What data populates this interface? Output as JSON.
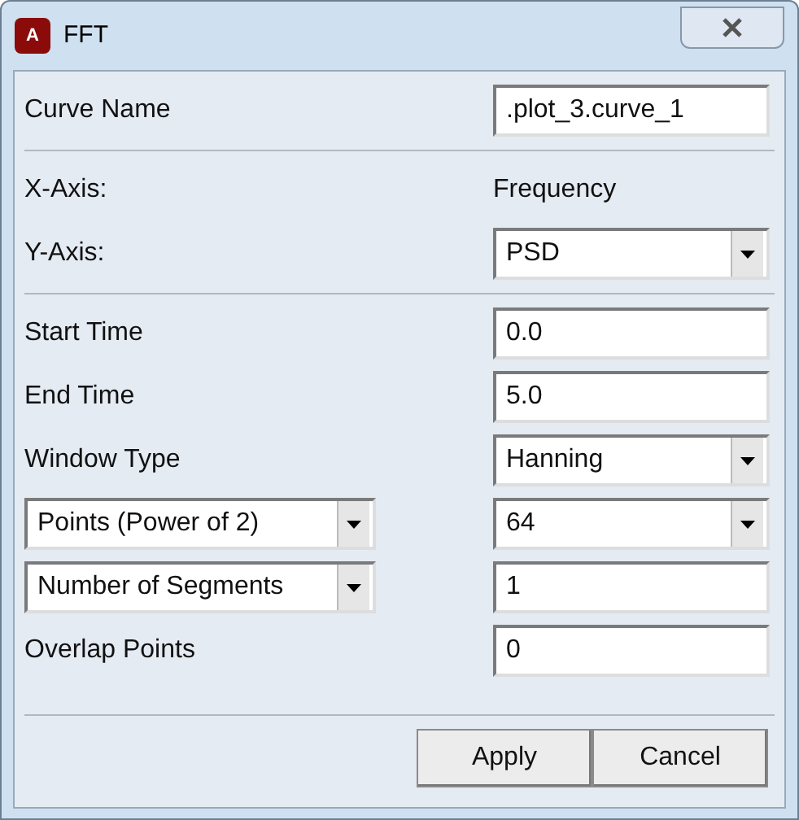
{
  "window": {
    "title": "FFT",
    "icon_letter": "A"
  },
  "sections": [
    [
      {
        "label": {
          "kind": "text",
          "text": "Curve Name"
        },
        "value": {
          "kind": "input",
          "text": ".plot_3.curve_1"
        }
      }
    ],
    [
      {
        "label": {
          "kind": "text",
          "text": "X-Axis:"
        },
        "value": {
          "kind": "text",
          "text": "Frequency"
        }
      },
      {
        "label": {
          "kind": "text",
          "text": "Y-Axis:"
        },
        "value": {
          "kind": "select",
          "text": "PSD"
        }
      }
    ],
    [
      {
        "label": {
          "kind": "text",
          "text": "Start Time"
        },
        "value": {
          "kind": "input",
          "text": "0.0"
        }
      },
      {
        "label": {
          "kind": "text",
          "text": "End Time"
        },
        "value": {
          "kind": "input",
          "text": "5.0"
        }
      },
      {
        "label": {
          "kind": "text",
          "text": "Window Type"
        },
        "value": {
          "kind": "select",
          "text": "Hanning"
        }
      },
      {
        "label": {
          "kind": "select",
          "text": "Points (Power of 2)"
        },
        "value": {
          "kind": "select",
          "text": "64"
        }
      },
      {
        "label": {
          "kind": "select",
          "text": "Number of Segments"
        },
        "value": {
          "kind": "input",
          "text": "1"
        }
      },
      {
        "label": {
          "kind": "text",
          "text": "Overlap Points"
        },
        "value": {
          "kind": "input",
          "text": "0"
        }
      }
    ]
  ],
  "buttons": [
    "Apply",
    "Cancel"
  ]
}
